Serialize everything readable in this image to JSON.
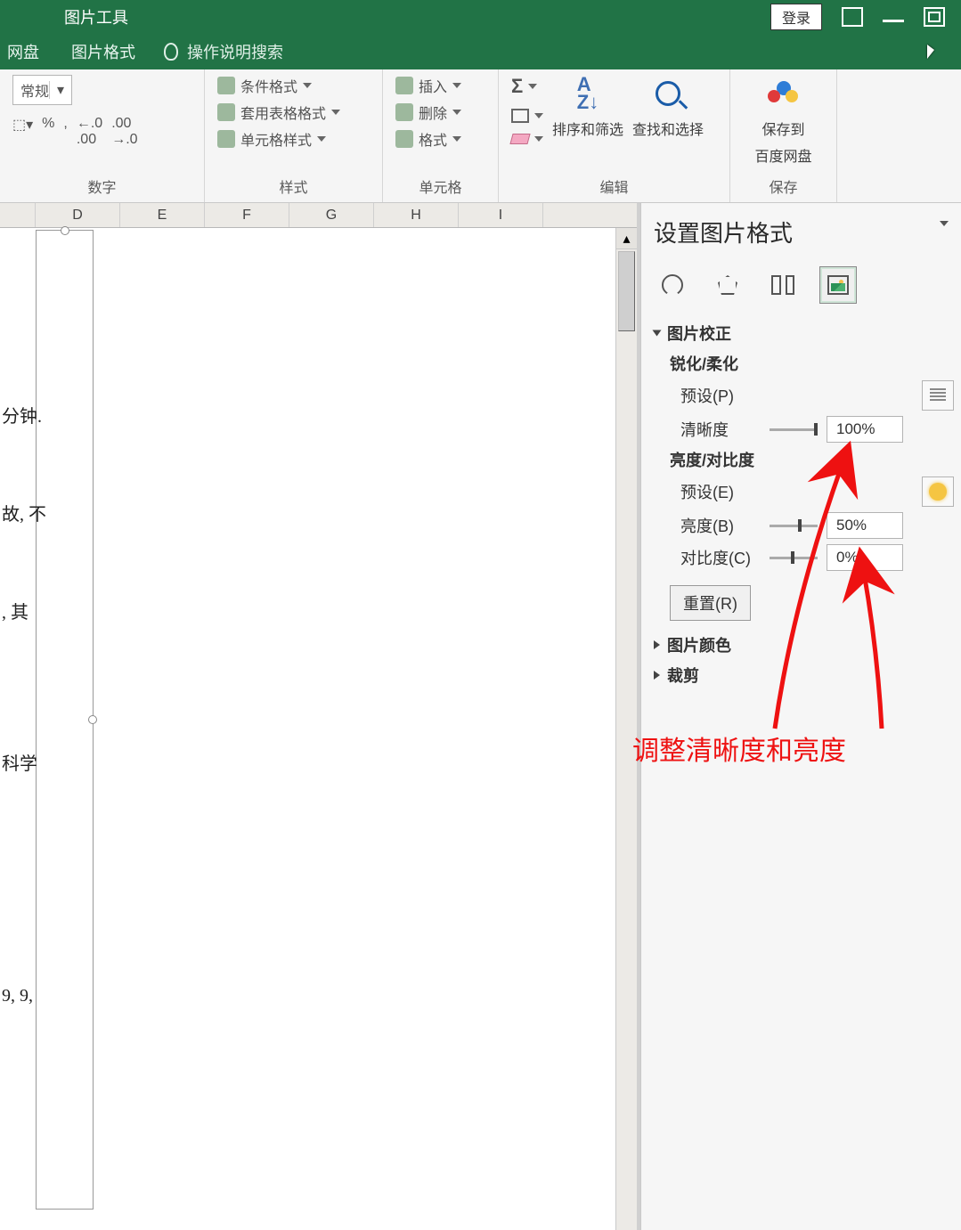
{
  "titlebar": {
    "context_tool": "图片工具",
    "login": "登录"
  },
  "tabs": {
    "cloud": "网盘",
    "picture_format": "图片格式",
    "tell_me": "操作说明搜索"
  },
  "ribbon": {
    "number": {
      "format_combo": "常规",
      "percent": "%",
      "comma": ",",
      "inc_dec": ".00",
      "dec_dec": ".00",
      "label": "数字"
    },
    "styles": {
      "cond_format": "条件格式",
      "table_format": "套用表格格式",
      "cell_style": "单元格样式",
      "label": "样式"
    },
    "cells": {
      "insert": "插入",
      "delete": "删除",
      "format": "格式",
      "label": "单元格"
    },
    "editing": {
      "sort_filter": "排序和筛选",
      "find_select": "查找和选择",
      "label": "编辑"
    },
    "save": {
      "save_to": "保存到",
      "cloud": "百度网盘",
      "label": "保存"
    }
  },
  "columns": [
    "",
    "D",
    "E",
    "F",
    "G",
    "H",
    "I"
  ],
  "doc_fragments": {
    "t1": "分钟.",
    "t2": "故, 不",
    "t3": ", 其",
    "t4": "科学",
    "t5": "9, 9,"
  },
  "pane": {
    "title": "设置图片格式",
    "section_correction": "图片校正",
    "sharpen_soften": "锐化/柔化",
    "preset_p": "预设(P)",
    "sharpness": "清晰度",
    "sharpness_val": "100%",
    "bright_contrast": "亮度/对比度",
    "preset_e": "预设(E)",
    "brightness": "亮度(B)",
    "brightness_val": "50%",
    "contrast": "对比度(C)",
    "contrast_val": "0%",
    "reset": "重置(R)",
    "section_color": "图片颜色",
    "section_crop": "裁剪"
  },
  "annotation": "调整清晰度和亮度"
}
